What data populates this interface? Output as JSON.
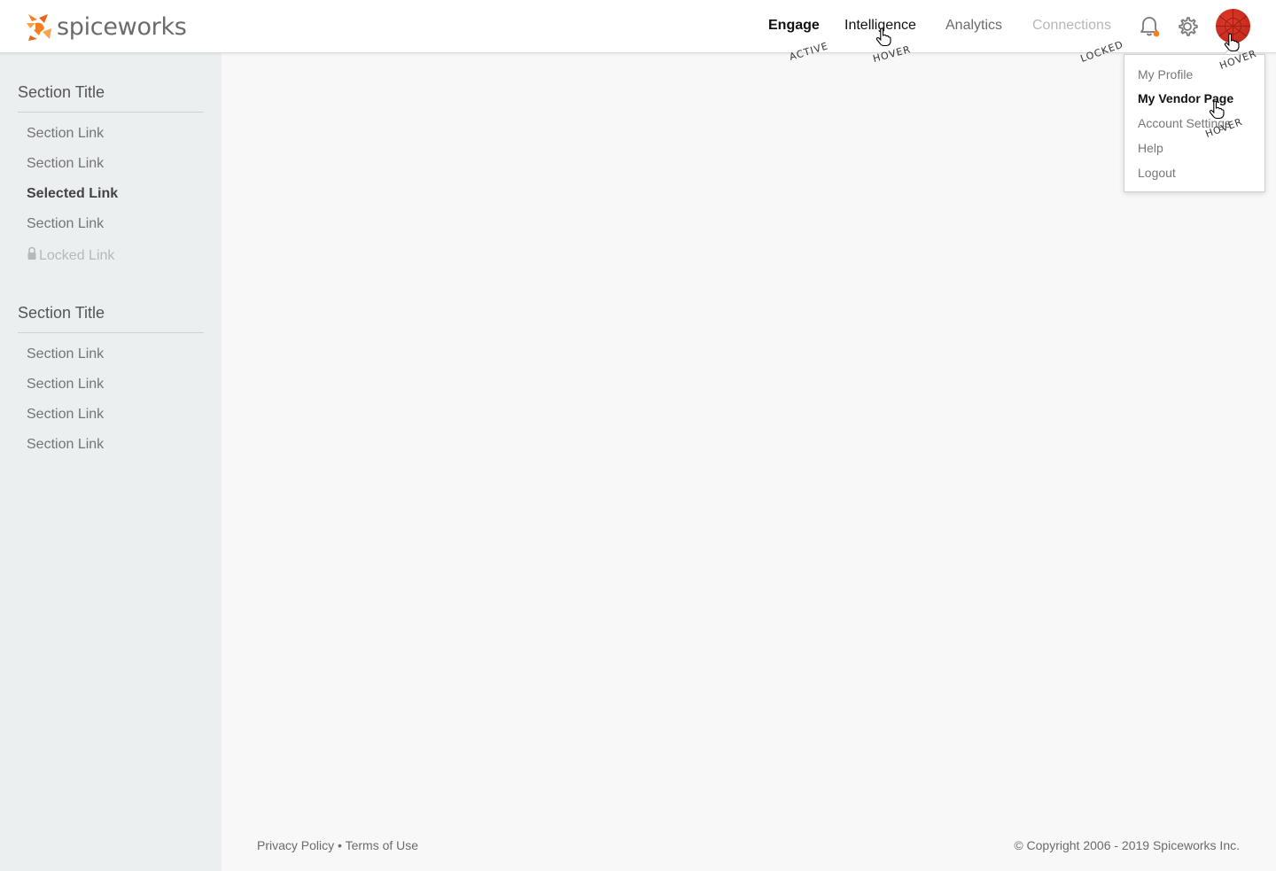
{
  "brand": {
    "name": "spiceworks",
    "accent": "#f57f20"
  },
  "nav": {
    "items": [
      {
        "label": "Engage",
        "state": "ACTIVE"
      },
      {
        "label": "Intelligence",
        "state": "HOVER"
      },
      {
        "label": "Analytics",
        "state": ""
      },
      {
        "label": "Connections",
        "state": "LOCKED"
      }
    ],
    "icons": [
      "bell-icon",
      "gear-icon"
    ],
    "notification_dot_color": "#f57f20",
    "avatar_state": "HOVER"
  },
  "sidebar": {
    "sections": [
      {
        "title": "Section Title",
        "links": [
          {
            "label": "Section Link"
          },
          {
            "label": "Section Link"
          },
          {
            "label": "Selected Link",
            "selected": true
          },
          {
            "label": "Section Link"
          },
          {
            "label": "Locked Link",
            "locked": true
          }
        ]
      },
      {
        "title": "Section Title",
        "links": [
          {
            "label": "Section Link"
          },
          {
            "label": "Section Link"
          },
          {
            "label": "Section Link"
          },
          {
            "label": "Section Link"
          }
        ]
      }
    ]
  },
  "user_menu": {
    "items": [
      "My Profile",
      "My Vendor Page",
      "Account Settings",
      "Help",
      "Logout"
    ],
    "hover_label": "HOVER"
  },
  "footer": {
    "privacy": "Privacy Policy",
    "separator": "•",
    "terms": "Terms of Use",
    "copyright": "© Copyright 2006 - 2019 Spiceworks Inc."
  }
}
